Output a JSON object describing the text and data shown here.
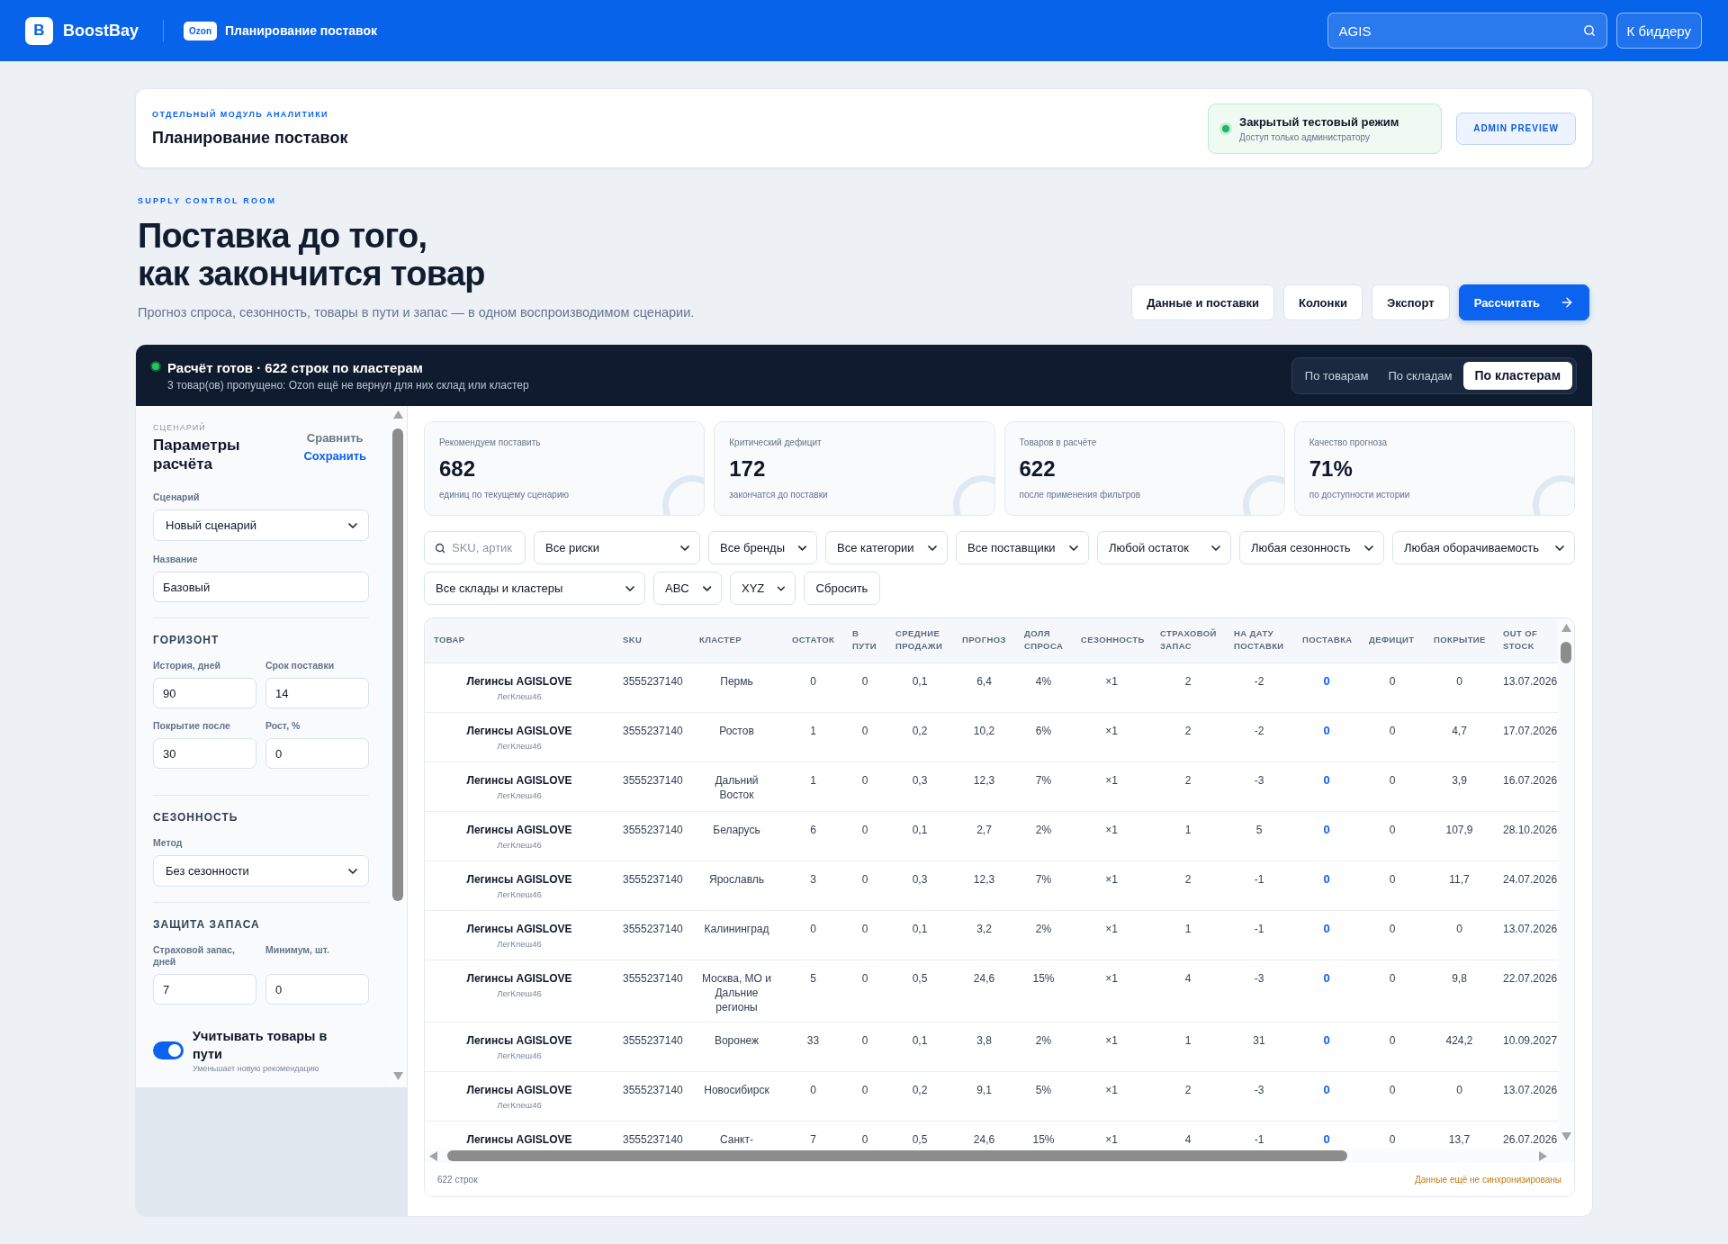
{
  "header": {
    "brand_mark": "B",
    "brand_name": "BoostBay",
    "marketplace": "Ozon",
    "title": "Планирование поставок",
    "search": {
      "value": "AGIS"
    },
    "bidder_button": "К биддеру"
  },
  "module_card": {
    "eyebrow": "ОТДЕЛЬНЫЙ МОДУЛЬ АНАЛИТИКИ",
    "title": "Планирование поставок",
    "status": {
      "title": "Закрытый тестовый режим",
      "caption": "Доступ только администратору"
    },
    "preview_button": "ADMIN PREVIEW"
  },
  "hero": {
    "eyebrow": "SUPPLY CONTROL ROOM",
    "title": "Поставка до того,\nкак закончится товар",
    "subtitle": "Прогноз спроса, сезонность, товары в пути и запас — в одном воспроизводимом сценарии.",
    "actions": [
      {
        "label": "Данные и поставки",
        "kind": "secondary"
      },
      {
        "label": "Колонки",
        "kind": "secondary"
      },
      {
        "label": "Экспорт",
        "kind": "secondary"
      },
      {
        "label": "Рассчитать",
        "kind": "primary"
      }
    ]
  },
  "result_banner": {
    "title": "Расчёт готов · 622 строк по кластерам",
    "subtitle": "3 товар(ов) пропущено: Ozon ещё не вернул для них склад или кластер",
    "views": [
      {
        "label": "По товарам",
        "selected": false
      },
      {
        "label": "По складам",
        "selected": false
      },
      {
        "label": "По кластерам",
        "selected": true
      }
    ]
  },
  "sidebar": {
    "eyebrow": "СЦЕНАРИЙ",
    "title": "Параметры расчёта",
    "links": [
      {
        "label": "Сравнить",
        "kind": "muted"
      },
      {
        "label": "Сохранить",
        "kind": "accent"
      }
    ],
    "sections": [
      {
        "kind": "stack",
        "fields": [
          {
            "label": "Сценарий",
            "kind": "select",
            "value": "Новый сценарий"
          },
          {
            "label": "Название",
            "kind": "input",
            "value": "Базовый"
          }
        ]
      },
      {
        "heading": "ГОРИЗОНТ",
        "kind": "pair",
        "fields": [
          {
            "label": "История, дней",
            "kind": "input",
            "value": "90"
          },
          {
            "label": "Срок поставки",
            "kind": "input",
            "value": "14"
          },
          {
            "label": "Покрытие после",
            "kind": "input",
            "value": "30"
          },
          {
            "label": "Рост, %",
            "kind": "input",
            "value": "0"
          }
        ]
      },
      {
        "heading": "СЕЗОННОСТЬ",
        "kind": "stack",
        "fields": [
          {
            "label": "Метод",
            "kind": "select",
            "value": "Без сезонности"
          }
        ]
      },
      {
        "heading": "ЗАЩИТА ЗАПАСА",
        "kind": "pair",
        "fields": [
          {
            "label": "Страховой запас, дней",
            "kind": "input",
            "value": "7"
          },
          {
            "label": "Минимум, шт.",
            "kind": "input",
            "value": "0"
          }
        ]
      }
    ],
    "toggle": {
      "label": "Учитывать товары в пути",
      "caption": "Уменьшает новую рекомендацию",
      "on": true
    }
  },
  "kpis": [
    {
      "label": "Рекомендуем поставить",
      "value": "682",
      "caption": "единиц по текущему сценарию"
    },
    {
      "label": "Критический дефицит",
      "value": "172",
      "caption": "закончатся до поставки"
    },
    {
      "label": "Товаров в расчёте",
      "value": "622",
      "caption": "после применения фильтров"
    },
    {
      "label": "Качество прогноза",
      "value": "71%",
      "caption": "по доступности истории"
    }
  ],
  "filter_rows": [
    [
      {
        "kind": "search",
        "placeholder": "SKU, артик"
      },
      {
        "kind": "select",
        "value": "Все риски"
      },
      {
        "kind": "select",
        "value": "Все бренды"
      },
      {
        "kind": "select",
        "value": "Все категории"
      },
      {
        "kind": "select",
        "value": "Все поставщики"
      },
      {
        "kind": "select",
        "value": "Любой остаток"
      },
      {
        "kind": "select",
        "value": "Любая сезонность"
      },
      {
        "kind": "select",
        "value": "Любая оборачиваемость"
      }
    ],
    [
      {
        "kind": "select",
        "value": "Все склады и кластеры"
      },
      {
        "kind": "select",
        "value": "ABC"
      },
      {
        "kind": "select",
        "value": "XYZ"
      },
      {
        "kind": "button",
        "label": "Сбросить"
      }
    ]
  ],
  "table": {
    "columns": [
      {
        "label": "ТОВАР",
        "kind": "product"
      },
      {
        "label": "SKU",
        "kind": "left"
      },
      {
        "label": "КЛАСТЕР",
        "kind": "center"
      },
      {
        "label": "ОСТАТОК",
        "kind": "center"
      },
      {
        "label": "В ПУТИ",
        "kind": "center"
      },
      {
        "label": "СРЕДНИЕ ПРОДАЖИ",
        "kind": "center"
      },
      {
        "label": "ПРОГНОЗ",
        "kind": "center"
      },
      {
        "label": "ДОЛЯ СПРОСА",
        "kind": "center"
      },
      {
        "label": "СЕЗОННОСТЬ",
        "kind": "center"
      },
      {
        "label": "СТРАХОВОЙ ЗАПАС",
        "kind": "center"
      },
      {
        "label": "НА ДАТУ ПОСТАВКИ",
        "kind": "center"
      },
      {
        "label": "ПОСТАВКА",
        "kind": "accent"
      },
      {
        "label": "ДЕФИЦИТ",
        "kind": "center"
      },
      {
        "label": "ПОКРЫТИЕ",
        "kind": "center"
      },
      {
        "label": "OUT OF STOCK",
        "kind": "left"
      }
    ],
    "rows": [
      {
        "cells": [
          {
            "name": "Легинсы AGISLOVE",
            "article": "ЛегКлеш46"
          },
          "3555237140",
          "Пермь",
          "0",
          "0",
          "0,1",
          "6,4",
          "4%",
          "×1",
          "2",
          "-2",
          "0",
          "0",
          "0",
          "13.07.2026"
        ]
      },
      {
        "cells": [
          {
            "name": "Легинсы AGISLOVE",
            "article": "ЛегКлеш46"
          },
          "3555237140",
          "Ростов",
          "1",
          "0",
          "0,2",
          "10,2",
          "6%",
          "×1",
          "2",
          "-2",
          "0",
          "0",
          "4,7",
          "17.07.2026"
        ]
      },
      {
        "cells": [
          {
            "name": "Легинсы AGISLOVE",
            "article": "ЛегКлеш46"
          },
          "3555237140",
          "Дальний Восток",
          "1",
          "0",
          "0,3",
          "12,3",
          "7%",
          "×1",
          "2",
          "-3",
          "0",
          "0",
          "3,9",
          "16.07.2026"
        ]
      },
      {
        "cells": [
          {
            "name": "Легинсы AGISLOVE",
            "article": "ЛегКлеш46"
          },
          "3555237140",
          "Беларусь",
          "6",
          "0",
          "0,1",
          "2,7",
          "2%",
          "×1",
          "1",
          "5",
          "0",
          "0",
          "107,9",
          "28.10.2026"
        ]
      },
      {
        "cells": [
          {
            "name": "Легинсы AGISLOVE",
            "article": "ЛегКлеш46"
          },
          "3555237140",
          "Ярославль",
          "3",
          "0",
          "0,3",
          "12,3",
          "7%",
          "×1",
          "2",
          "-1",
          "0",
          "0",
          "11,7",
          "24.07.2026"
        ]
      },
      {
        "cells": [
          {
            "name": "Легинсы AGISLOVE",
            "article": "ЛегКлеш46"
          },
          "3555237140",
          "Калининград",
          "0",
          "0",
          "0,1",
          "3,2",
          "2%",
          "×1",
          "1",
          "-1",
          "0",
          "0",
          "0",
          "13.07.2026"
        ]
      },
      {
        "cells": [
          {
            "name": "Легинсы AGISLOVE",
            "article": "ЛегКлеш46"
          },
          "3555237140",
          "Москва, МО и Дальние регионы",
          "5",
          "0",
          "0,5",
          "24,6",
          "15%",
          "×1",
          "4",
          "-3",
          "0",
          "0",
          "9,8",
          "22.07.2026"
        ]
      },
      {
        "cells": [
          {
            "name": "Легинсы AGISLOVE",
            "article": "ЛегКлеш46"
          },
          "3555237140",
          "Воронеж",
          "33",
          "0",
          "0,1",
          "3,8",
          "2%",
          "×1",
          "1",
          "31",
          "0",
          "0",
          "424,2",
          "10.09.2027"
        ]
      },
      {
        "cells": [
          {
            "name": "Легинсы AGISLOVE",
            "article": "ЛегКлеш46"
          },
          "3555237140",
          "Новосибирск",
          "0",
          "0",
          "0,2",
          "9,1",
          "5%",
          "×1",
          "2",
          "-3",
          "0",
          "0",
          "0",
          "13.07.2026"
        ]
      },
      {
        "cells": [
          {
            "name": "Легинсы AGISLOVE"
          },
          "3555237140",
          "Санкт-",
          "7",
          "0",
          "0,5",
          "24,6",
          "15%",
          "×1",
          "4",
          "-1",
          "0",
          "0",
          "13,7",
          "26.07.2026"
        ]
      }
    ],
    "footer": {
      "count": "622 строк",
      "sync_note": "Данные ещё не синхронизированы"
    }
  }
}
